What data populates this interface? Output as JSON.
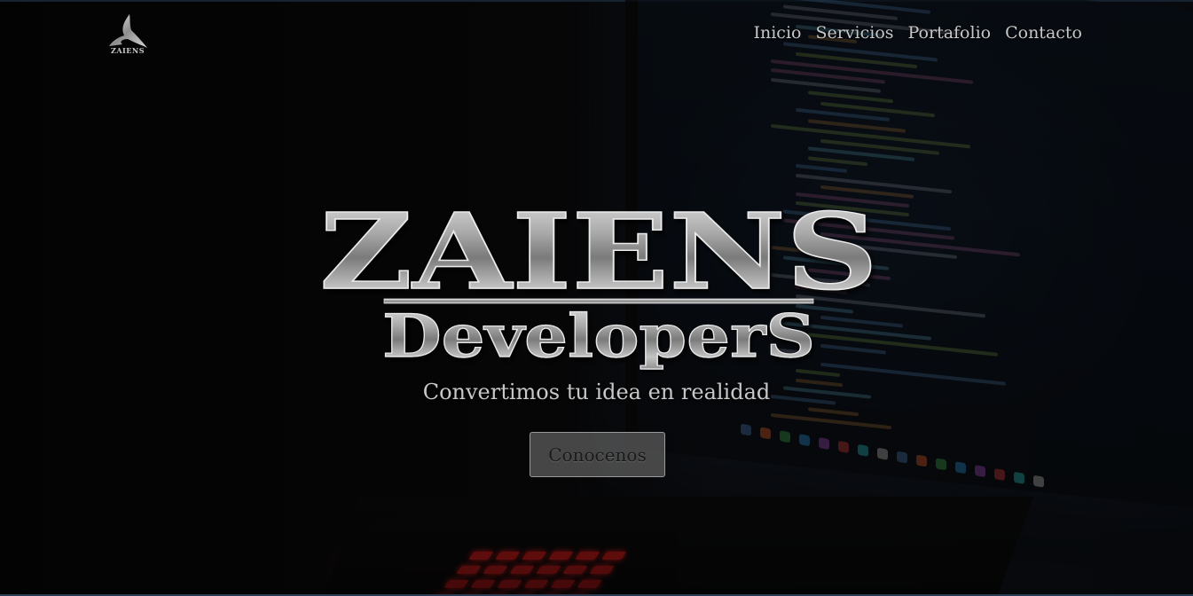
{
  "brand": {
    "logo_text": "ZAIENS",
    "title": "ZAIENS",
    "subtitle": "DeveloperS"
  },
  "nav": {
    "items": [
      {
        "label": "Inicio"
      },
      {
        "label": "Servicios"
      },
      {
        "label": "Portafolio"
      },
      {
        "label": "Contacto"
      }
    ]
  },
  "hero": {
    "tagline": "Convertimos tu idea en realidad",
    "cta_label": "Conocenos"
  },
  "colors": {
    "accent_metal": "#b5b5b5",
    "nav_text": "#c7c7c7",
    "background": "#050505"
  },
  "icons": {
    "logo": "zaiens-logo-icon"
  }
}
